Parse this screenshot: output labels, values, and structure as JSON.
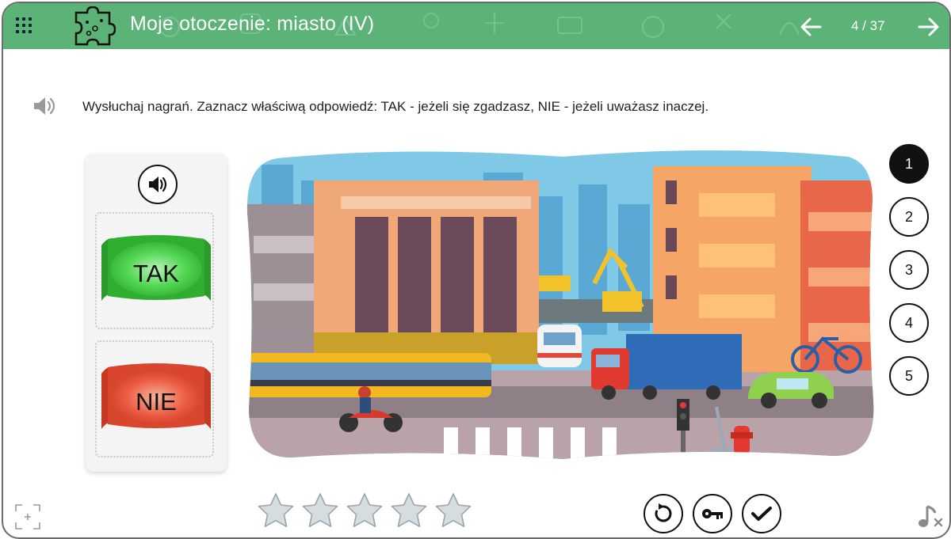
{
  "header": {
    "title": "Moje otoczenie: miasto (IV)",
    "page_counter": "4 / 37",
    "icons": [
      "grid-menu-icon",
      "puzzle-icon",
      "arrow-left-icon",
      "arrow-right-icon"
    ],
    "color": "#5cb377"
  },
  "instruction": {
    "text": "Wysłuchaj nagrań. Zaznacz właściwą odpowiedź: TAK - jeżeli się zgadzasz,  NIE - jeżeli uważasz inaczej."
  },
  "answers": {
    "yes_label": "TAK",
    "no_label": "NIE",
    "yes_color": "#4fcf4f",
    "no_color": "#e8563e"
  },
  "questions": {
    "items": [
      "1",
      "2",
      "3",
      "4",
      "5"
    ],
    "active": "1"
  },
  "rating": {
    "stars_total": 5,
    "stars_filled": 0
  },
  "controls": {
    "icons": [
      "restart-icon",
      "key-icon",
      "check-icon"
    ]
  },
  "corners": {
    "icons": [
      "fullscreen-icon",
      "music-off-icon"
    ]
  }
}
